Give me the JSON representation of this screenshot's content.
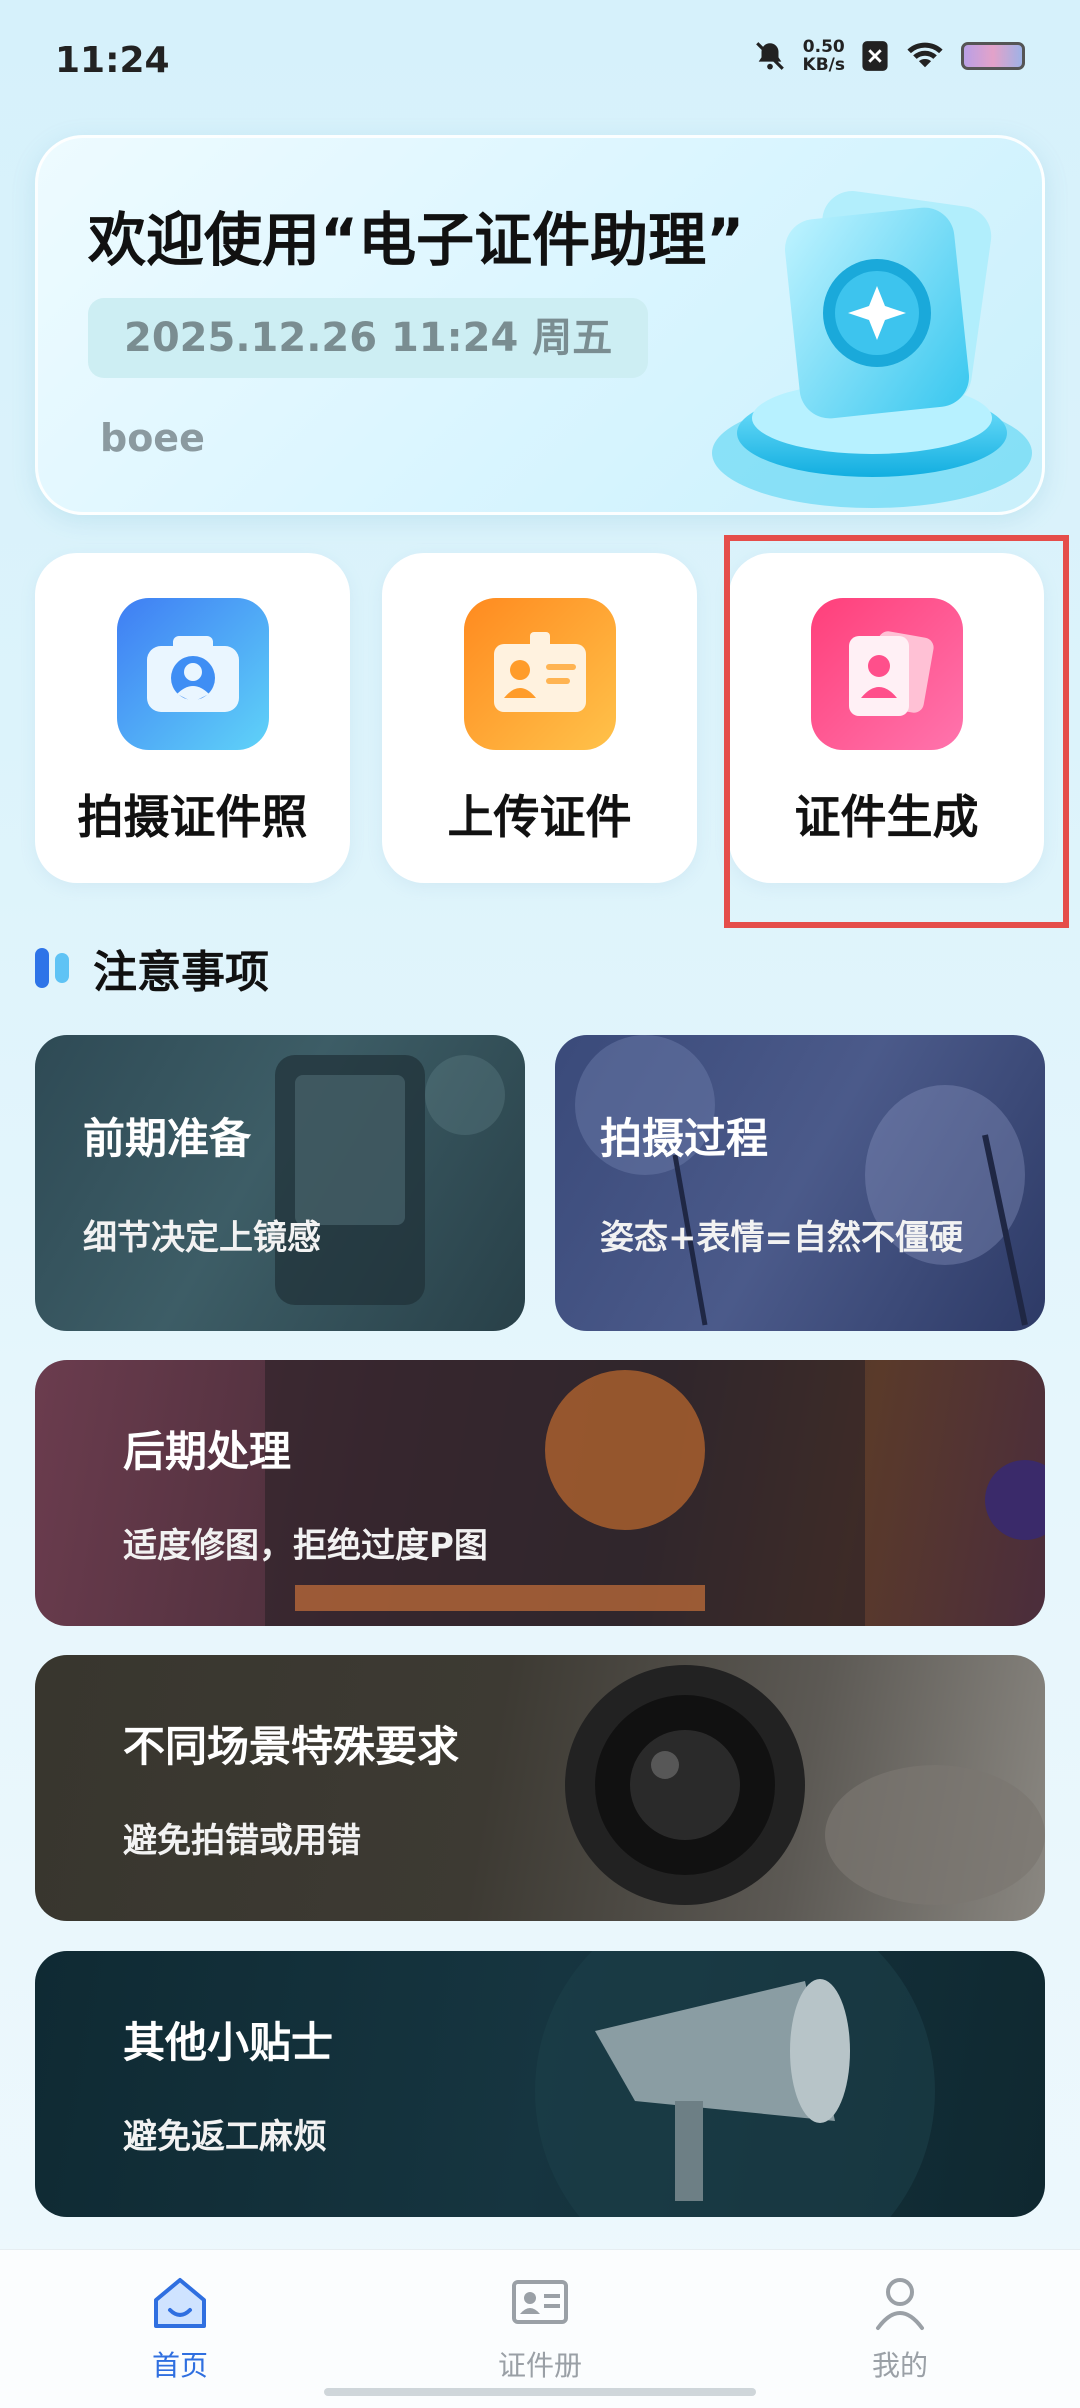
{
  "status": {
    "time": "11:24",
    "speed_value": "0.50",
    "speed_unit": "KB/s"
  },
  "welcome": {
    "title": "欢迎使用“电子证件助理”",
    "datetime": "2025.12.26 11:24 周五",
    "username": "boee"
  },
  "tiles": [
    {
      "label": "拍摄证件照",
      "icon": "camera-icon",
      "color": "#3e8cf5"
    },
    {
      "label": "上传证件",
      "icon": "id-card-icon",
      "color": "#ff9c2a"
    },
    {
      "label": "证件生成",
      "icon": "portrait-id-icon",
      "color": "#ff4f8b"
    }
  ],
  "section": {
    "title": "注意事项"
  },
  "notices": [
    {
      "title": "前期准备",
      "subtitle": "细节决定上镜感"
    },
    {
      "title": "拍摄过程",
      "subtitle": "姿态+表情=自然不僵硬"
    },
    {
      "title": "后期处理",
      "subtitle": "适度修图，拒绝过度P图"
    },
    {
      "title": "不同场景特殊要求",
      "subtitle": "避免拍错或用错"
    },
    {
      "title": "其他小贴士",
      "subtitle": "避免返工麻烦"
    }
  ],
  "nav": [
    {
      "label": "首页",
      "icon": "home-icon",
      "active": true
    },
    {
      "label": "证件册",
      "icon": "id-album-icon",
      "active": false
    },
    {
      "label": "我的",
      "icon": "profile-icon",
      "active": false
    }
  ],
  "colors": {
    "accent": "#2f6fe0",
    "highlight": "#e54d4a"
  }
}
